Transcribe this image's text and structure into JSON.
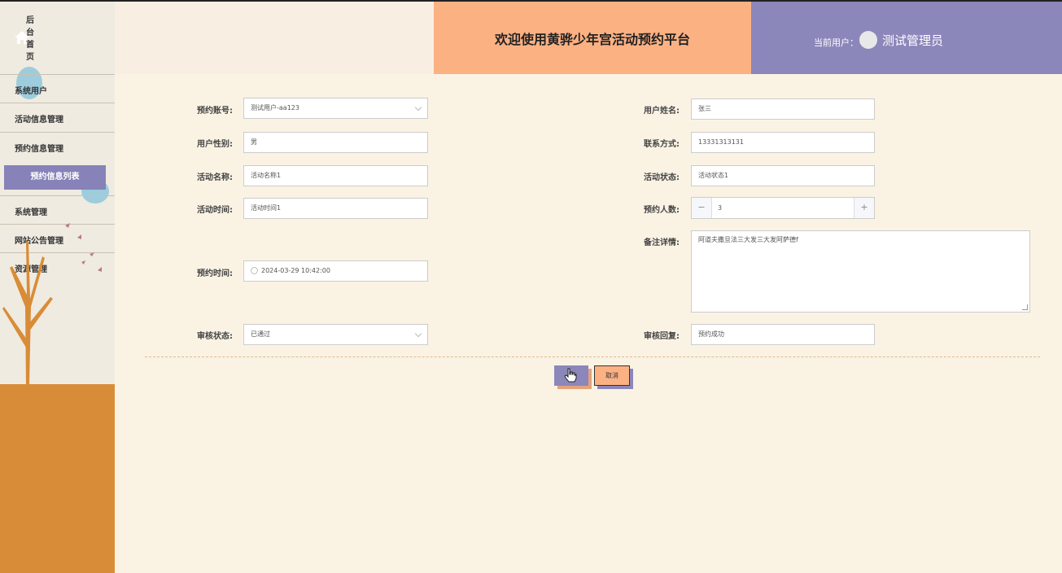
{
  "sidebar": {
    "home_label": "后台首页",
    "items": [
      {
        "label": "系统用户"
      },
      {
        "label": "活动信息管理"
      },
      {
        "label": "预约信息管理"
      },
      {
        "label": "系统管理"
      },
      {
        "label": "网站公告管理"
      },
      {
        "label": "资源管理"
      }
    ],
    "active_sub": "预约信息列表"
  },
  "header": {
    "title": "欢迎使用黄骅少年宫活动预约平台",
    "current_user_label": "当前用户：",
    "username": "测试管理员"
  },
  "form": {
    "account": {
      "label": "预约账号:",
      "value": "测试用户-aa123"
    },
    "gender": {
      "label": "用户性别:",
      "value": "男"
    },
    "activity_name": {
      "label": "活动名称:",
      "value": "活动名称1"
    },
    "activity_time": {
      "label": "活动时间:",
      "value": "活动时间1"
    },
    "booking_time": {
      "label": "预约时间:",
      "value": "2024-03-29 10:42:00"
    },
    "review_status": {
      "label": "审核状态:",
      "value": "已通过"
    },
    "user_name": {
      "label": "用户姓名:",
      "value": "张三"
    },
    "contact": {
      "label": "联系方式:",
      "value": "13331313131"
    },
    "activity_status": {
      "label": "活动状态:",
      "value": "活动状态1"
    },
    "people_count": {
      "label": "预约人数:",
      "value": "3",
      "minus": "−",
      "plus": "+"
    },
    "remarks": {
      "label": "备注详情:",
      "value": "阿道夫撒旦法三大发三大发阿萨德f"
    },
    "review_reply": {
      "label": "审核回复:",
      "value": "预约成功"
    }
  },
  "buttons": {
    "cancel": "取消"
  },
  "colors": {
    "purple": "#8b87ba",
    "peach": "#fcb183",
    "orange": "#d98c37"
  }
}
